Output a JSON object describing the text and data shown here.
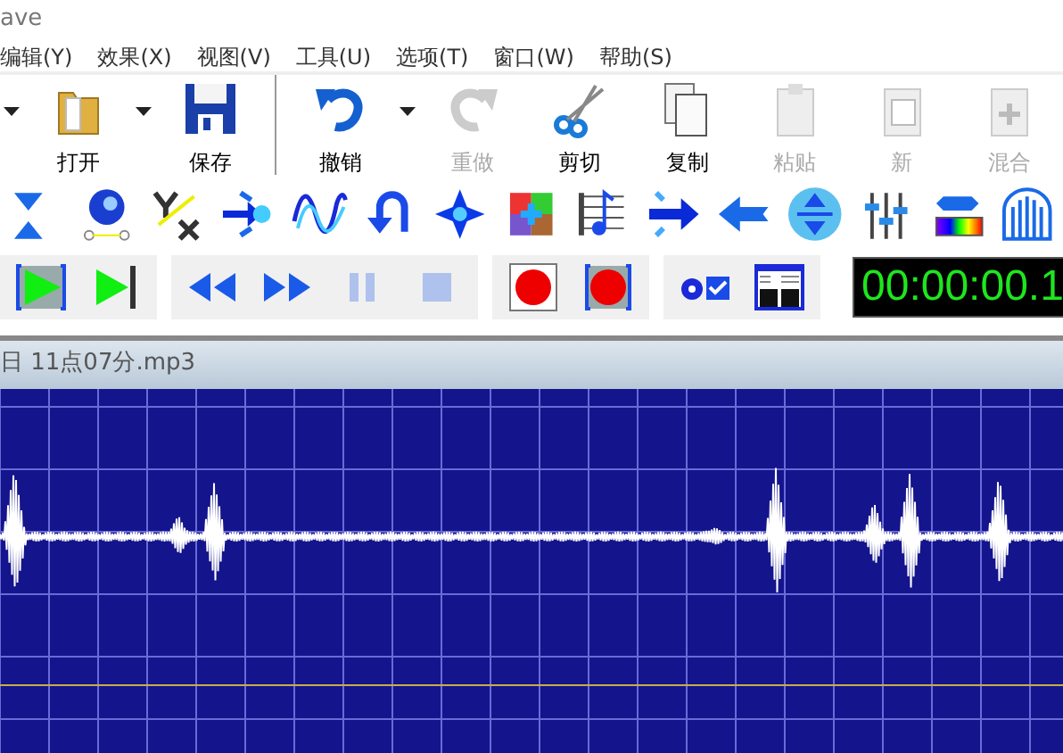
{
  "window": {
    "title": "ave"
  },
  "menu": [
    "编辑(Y)",
    "效果(X)",
    "视图(V)",
    "工具(U)",
    "选项(T)",
    "窗口(W)",
    "帮助(S)"
  ],
  "toolbar": [
    {
      "kind": "caret"
    },
    {
      "kind": "open",
      "label": "打开",
      "disabled": false
    },
    {
      "kind": "caret"
    },
    {
      "kind": "save",
      "label": "保存",
      "disabled": false
    },
    {
      "kind": "separator"
    },
    {
      "kind": "undo",
      "label": "撤销",
      "disabled": false
    },
    {
      "kind": "caret"
    },
    {
      "kind": "redo",
      "label": "重做",
      "disabled": true
    },
    {
      "kind": "cut",
      "label": "剪切",
      "disabled": false
    },
    {
      "kind": "copy",
      "label": "复制",
      "disabled": false
    },
    {
      "kind": "paste",
      "label": "粘贴",
      "disabled": true
    },
    {
      "kind": "new",
      "label": "新",
      "disabled": true
    },
    {
      "kind": "mix",
      "label": "混合",
      "disabled": true
    }
  ],
  "transport_groups": [
    [
      {
        "kind": "play-selection",
        "disabled": false
      },
      {
        "kind": "play-to-end",
        "disabled": false
      }
    ],
    [
      {
        "kind": "rewind",
        "disabled": false
      },
      {
        "kind": "fast-forward",
        "disabled": false
      },
      {
        "kind": "pause",
        "disabled": true
      },
      {
        "kind": "stop",
        "disabled": true
      }
    ],
    [
      {
        "kind": "record",
        "disabled": false
      },
      {
        "kind": "record-selection",
        "disabled": false
      }
    ],
    [
      {
        "kind": "options",
        "disabled": false
      },
      {
        "kind": "window",
        "disabled": false
      }
    ]
  ],
  "timer": "00:00:00.1",
  "file_tab": {
    "title": "日 11点07分.mp3"
  }
}
